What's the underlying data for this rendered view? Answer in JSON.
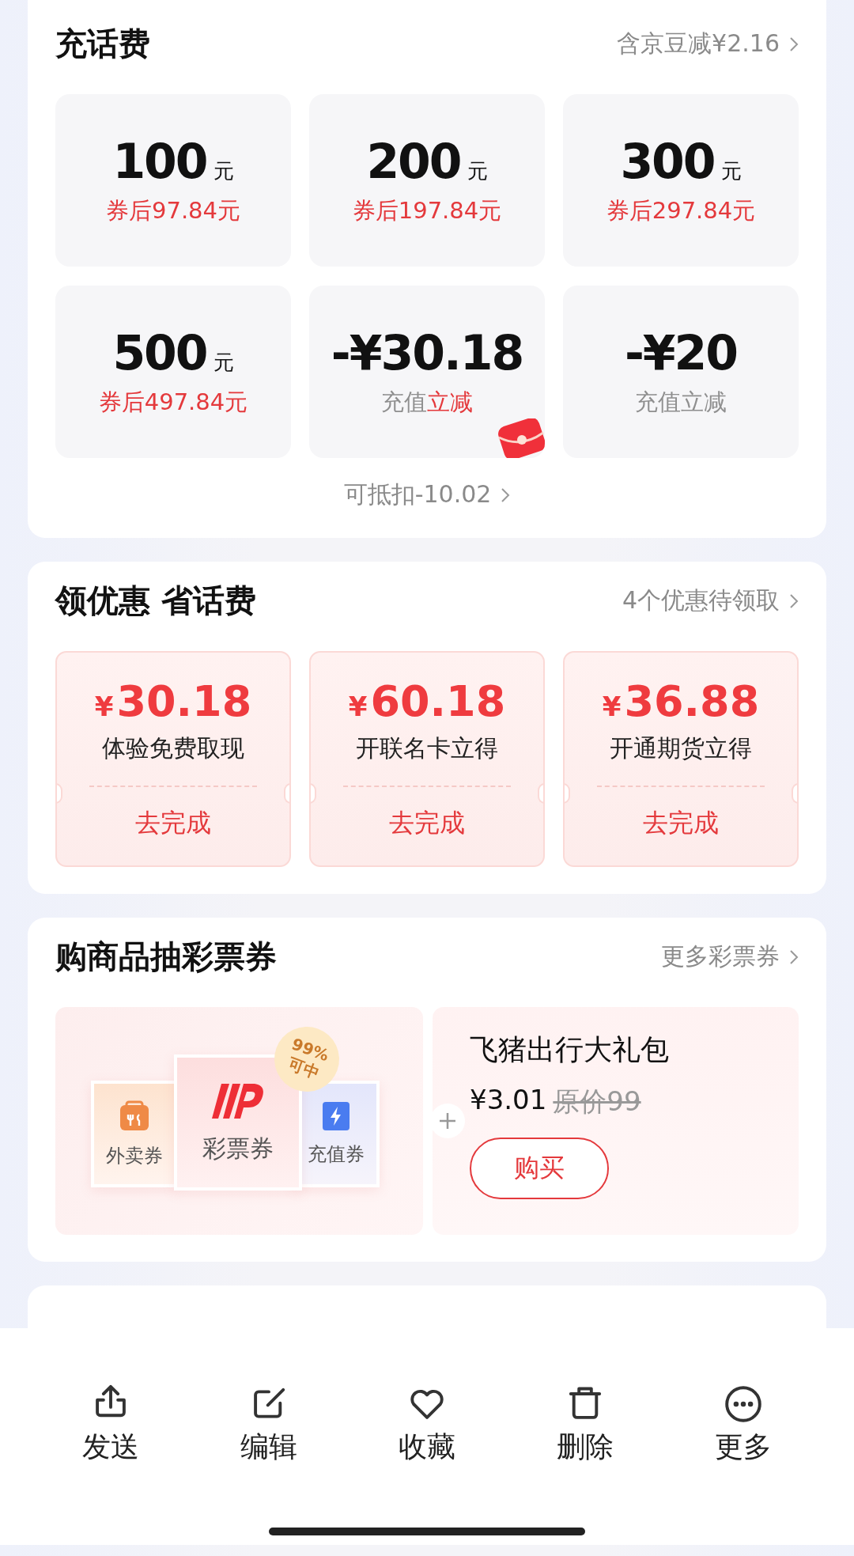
{
  "recharge": {
    "title": "充话费",
    "link": "含京豆减¥2.16",
    "tiles": [
      {
        "kind": "amount",
        "value": "100",
        "unit": "元",
        "note": [
          {
            "text": "券后97.84元",
            "highlight": true
          }
        ],
        "red_packet": false
      },
      {
        "kind": "amount",
        "value": "200",
        "unit": "元",
        "note": [
          {
            "text": "券后197.84元",
            "highlight": true
          }
        ],
        "red_packet": false
      },
      {
        "kind": "amount",
        "value": "300",
        "unit": "元",
        "note": [
          {
            "text": "券后297.84元",
            "highlight": true
          }
        ],
        "red_packet": false
      },
      {
        "kind": "amount",
        "value": "500",
        "unit": "元",
        "note": [
          {
            "text": "券后497.84元",
            "highlight": true
          }
        ],
        "red_packet": false
      },
      {
        "kind": "discount",
        "value": "-¥30.18",
        "note": [
          {
            "text": "充值",
            "highlight": false
          },
          {
            "text": "立减",
            "highlight": true
          }
        ],
        "red_packet": true
      },
      {
        "kind": "discount",
        "value": "-¥20",
        "note": [
          {
            "text": "充值立减",
            "highlight": false
          }
        ],
        "red_packet": false
      }
    ],
    "footer": "可抵扣-10.02"
  },
  "offers": {
    "title": "领优惠 省话费",
    "link": "4个优惠待领取",
    "coupons": [
      {
        "currency": "¥",
        "amount": "30.18",
        "desc": "体验免费取现",
        "action": "去完成"
      },
      {
        "currency": "¥",
        "amount": "60.18",
        "desc": "开联名卡立得",
        "action": "去完成"
      },
      {
        "currency": "¥",
        "amount": "36.88",
        "desc": "开通期货立得",
        "action": "去完成"
      }
    ]
  },
  "lottery": {
    "title": "购商品抽彩票券",
    "link": "更多彩票券",
    "tickets": [
      {
        "kind": "food",
        "label": "外卖券"
      },
      {
        "kind": "lottery",
        "label": "彩票券"
      },
      {
        "kind": "topup",
        "label": "充值券"
      }
    ],
    "badge": [
      "99%",
      "可中"
    ],
    "product": {
      "title": "飞猪出行大礼包",
      "price": "¥3.01",
      "original_price": "原价99",
      "button": "购买"
    }
  },
  "action_bar": [
    {
      "kind": "share",
      "label": "发送"
    },
    {
      "kind": "edit",
      "label": "编辑"
    },
    {
      "kind": "favorite",
      "label": "收藏"
    },
    {
      "kind": "delete",
      "label": "删除"
    },
    {
      "kind": "more",
      "label": "更多"
    }
  ]
}
